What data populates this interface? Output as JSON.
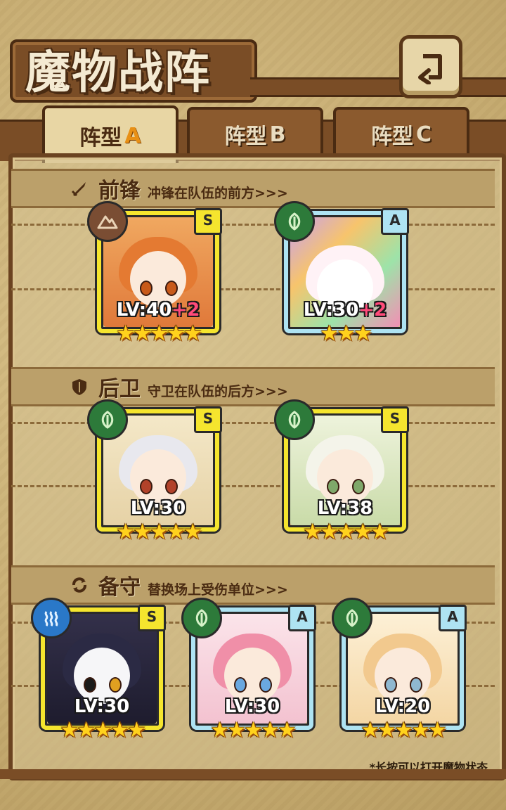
{
  "title": "魔物战阵",
  "tabs": [
    {
      "label": "阵型",
      "letter": "A",
      "active": true
    },
    {
      "label": "阵型",
      "letter": "B",
      "active": false
    },
    {
      "label": "阵型",
      "letter": "C",
      "active": false
    }
  ],
  "sections": {
    "front": {
      "title": "前锋",
      "desc": "冲锋在队伍的前方>>>"
    },
    "rear": {
      "title": "后卫",
      "desc": "守卫在队伍的后方>>>"
    },
    "reserve": {
      "title": "备守",
      "desc": "替换场上受伤单位>>>"
    }
  },
  "units": [
    {
      "level": "LV:40",
      "bonus": "+2",
      "rank": "S",
      "stars": "★★★★★",
      "element": "earth"
    },
    {
      "level": "LV:30",
      "bonus": "+2",
      "rank": "A",
      "stars": "★★★",
      "element": "nature"
    },
    {
      "level": "LV:30",
      "bonus": "",
      "rank": "S",
      "stars": "★★★★★",
      "element": "nature"
    },
    {
      "level": "LV:38",
      "bonus": "",
      "rank": "S",
      "stars": "★★★★★",
      "element": "nature"
    },
    {
      "level": "LV:30",
      "bonus": "",
      "rank": "S",
      "stars": "★★★★★",
      "element": "water"
    },
    {
      "level": "LV:30",
      "bonus": "",
      "rank": "A",
      "stars": "★★★★★",
      "element": "nature"
    },
    {
      "level": "LV:20",
      "bonus": "",
      "rank": "A",
      "stars": "★★★★★",
      "element": "nature"
    }
  ],
  "hint": "*长按可以打开魔物状态",
  "icons": {
    "back": "back-arrow-icon",
    "front": "sword-icon",
    "rear": "shield-icon",
    "reserve": "swap-icon",
    "earth": "mountain-icon",
    "nature": "leaf-icon",
    "water": "wave-icon"
  },
  "colors": {
    "rank_s": "#f5e52e",
    "rank_a": "#aee3f2",
    "element_earth": "#7a4d33",
    "element_nature": "#2d7a3a",
    "element_water": "#2a78c8",
    "bonus": "#ff4a7a"
  }
}
